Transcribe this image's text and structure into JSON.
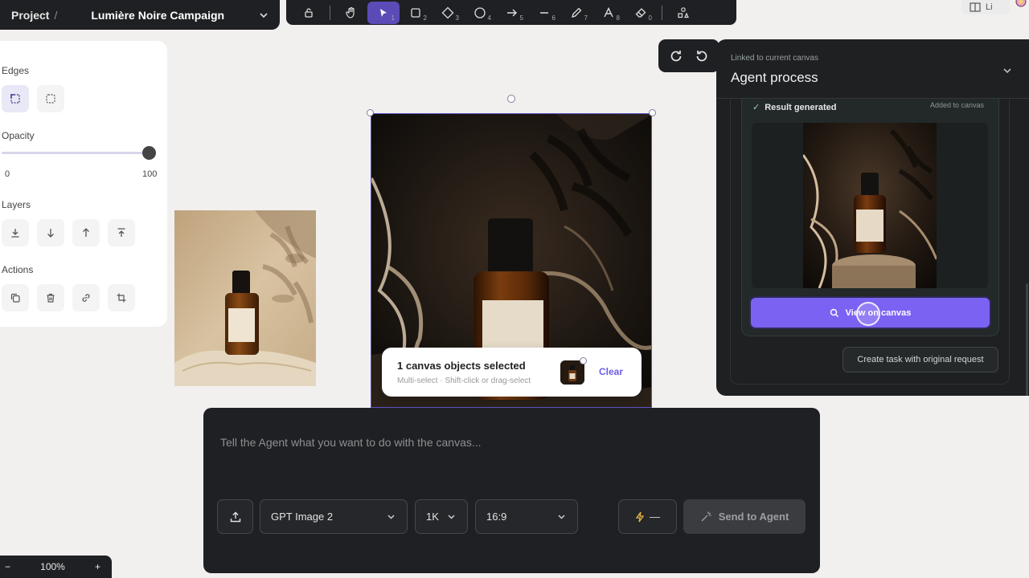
{
  "project": {
    "crumb": "Project",
    "separator": "/",
    "name": "Lumière Noire Campaign"
  },
  "toolbar": {
    "tools": [
      {
        "name": "lock-tool",
        "icon": "lock-icon",
        "num": ""
      },
      {
        "name": "hand-tool",
        "icon": "hand-icon",
        "num": ""
      },
      {
        "name": "select-tool",
        "icon": "pointer-icon",
        "num": "1"
      },
      {
        "name": "rectangle-tool",
        "icon": "square-icon",
        "num": "2"
      },
      {
        "name": "diamond-tool",
        "icon": "diamond-icon",
        "num": "3"
      },
      {
        "name": "ellipse-tool",
        "icon": "circle-icon",
        "num": "4"
      },
      {
        "name": "arrow-tool",
        "icon": "arrow-icon",
        "num": "5"
      },
      {
        "name": "line-tool",
        "icon": "line-icon",
        "num": "6"
      },
      {
        "name": "pencil-tool",
        "icon": "pencil-icon",
        "num": "7"
      },
      {
        "name": "text-tool",
        "icon": "text-icon",
        "num": "8"
      },
      {
        "name": "eraser-tool",
        "icon": "eraser-icon",
        "num": "0"
      },
      {
        "name": "shapes-tool",
        "icon": "shapes-icon",
        "num": ""
      }
    ],
    "active_tool": "select-tool"
  },
  "topright": {
    "label": "Li"
  },
  "props": {
    "edges_label": "Edges",
    "opacity_label": "Opacity",
    "opacity_value": 100,
    "opacity_min": "0",
    "opacity_max": "100",
    "layers_label": "Layers",
    "actions_label": "Actions"
  },
  "selection": {
    "title": "1 canvas objects selected",
    "hint": "Multi-select · Shift-click or drag-select",
    "clear_label": "Clear"
  },
  "agent": {
    "linked": "Linked to current canvas",
    "title": "Agent process",
    "result_label": "Result generated",
    "added_label": "Added to canvas",
    "view_button": "View on canvas",
    "create_task": "Create task with original request"
  },
  "prompt": {
    "placeholder": "Tell the Agent what you want to do with the canvas...",
    "model": "GPT Image 2",
    "resolution": "1K",
    "aspect": "16:9",
    "speed": "—",
    "send_label": "Send to Agent"
  },
  "zoom": {
    "minus": "−",
    "level": "100%",
    "plus": "+"
  },
  "colors": {
    "accent": "#7c62f2",
    "dark_panel": "#1f2023",
    "canvas_bg": "#f1f0ee"
  }
}
